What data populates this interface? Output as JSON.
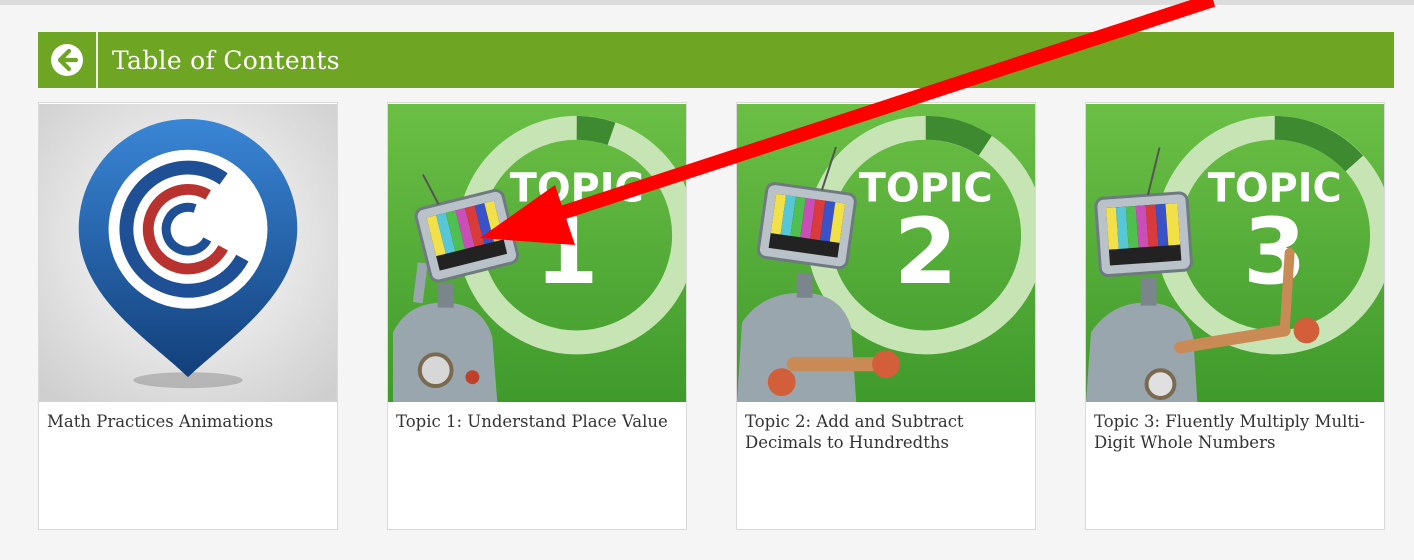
{
  "header": {
    "title": "Table of Contents",
    "back_icon": "arrow-left-circle-icon"
  },
  "cards": [
    {
      "label": "Math Practices Animations",
      "thumb_icon": "cc-logo-pin-icon"
    },
    {
      "label": "Topic 1: Understand Place Value",
      "badge_word": "TOPIC",
      "badge_number": "1"
    },
    {
      "label": "Topic 2: Add and Subtract Decimals to Hundredths",
      "badge_word": "TOPIC",
      "badge_number": "2"
    },
    {
      "label": "Topic 3: Fluently Multiply Multi-Digit Whole Numbers",
      "badge_word": "TOPIC",
      "badge_number": "3"
    }
  ],
  "colors": {
    "header_green": "#6ea522",
    "thumb_green": "#5aa83c",
    "logo_blue": "#1f5ea8",
    "annotation_arrow": "#ff0000"
  }
}
